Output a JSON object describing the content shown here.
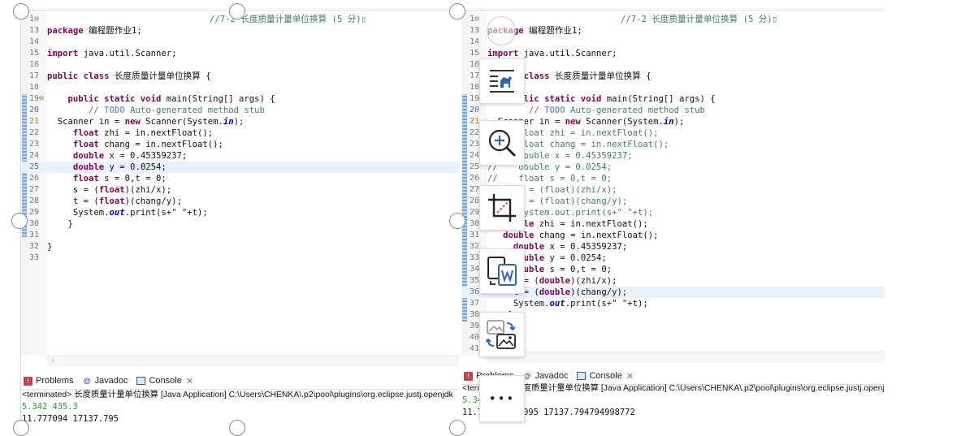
{
  "left": {
    "lines": [
      {
        "num": "1",
        "html": "<span style=\"padding-left:200px;color:#3f7f5f\">//7-2 长度质量计量单位换算 (5 分)▯</span>",
        "fold": true
      },
      {
        "num": "13",
        "html": "<span class=\"kw\">package</span> 编程题作业1;"
      },
      {
        "num": "14",
        "html": ""
      },
      {
        "num": "15",
        "html": "<span class=\"kw\">import</span> java.util.Scanner;"
      },
      {
        "num": "16",
        "html": ""
      },
      {
        "num": "17",
        "html": "<span class=\"kw\">public class</span> 长度质量计量单位换算 {"
      },
      {
        "num": "18",
        "html": ""
      },
      {
        "num": "19",
        "html": "    <span class=\"kw\">public static void</span> main(String[] args) {",
        "fold": true
      },
      {
        "num": "20",
        "html": "        <span class=\"cm\">// <span class=\"todo\">TODO</span> Auto-generated method stub</span>",
        "marker": "task"
      },
      {
        "num": "21",
        "html": "  Scanner in = <span class=\"kw\">new</span> Scanner(System.<span class=\"fld\">in</span>);",
        "marker": "warn"
      },
      {
        "num": "22",
        "html": "     <span class=\"kw\">float</span> zhi = in.nextFloat();"
      },
      {
        "num": "23",
        "html": "     <span class=\"kw\">float</span> chang = in.nextFloat();"
      },
      {
        "num": "24",
        "html": "     <span class=\"kw\">double</span> x = 0.45359237;"
      },
      {
        "num": "25",
        "html": "     <span class=\"kw\">double</span> y = 0.0254;",
        "hl": true
      },
      {
        "num": "26",
        "html": "     <span class=\"kw\">float</span> s = 0,t = 0;"
      },
      {
        "num": "27",
        "html": "     s = (<span class=\"kw\">float</span>)(zhi/x);"
      },
      {
        "num": "28",
        "html": "     t = (<span class=\"kw\">float</span>)(chang/y);"
      },
      {
        "num": "29",
        "html": "     System.<span class=\"fld\">out</span>.print(s+\" \"+t);"
      },
      {
        "num": "30",
        "html": "    }"
      },
      {
        "num": "31",
        "html": ""
      },
      {
        "num": "32",
        "html": "}"
      },
      {
        "num": "33",
        "html": ""
      }
    ],
    "tabs": {
      "problems": "Problems",
      "javadoc": "Javadoc",
      "console": "Console"
    },
    "terminated": "<terminated> 长度质量计量单位换算 [Java Application] C:\\Users\\CHENKA\\.p2\\pool\\plugins\\org.eclipse.justj.openjdk",
    "input": "5.342 435.3",
    "output": "11.777094 17137.795"
  },
  "right": {
    "lines": [
      {
        "num": "1",
        "html": "<span style=\"padding-left:164px;color:#3f7f5f\">//7-2 长度质量计量单位换算 (5 分)▯</span>",
        "fold": true
      },
      {
        "num": "13",
        "html": "<span class=\"kw\">package</span> 编程题作业1;"
      },
      {
        "num": "14",
        "html": ""
      },
      {
        "num": "15",
        "html": "<span class=\"kw\">import</span> java.util.Scanner;"
      },
      {
        "num": "16",
        "html": ""
      },
      {
        "num": "17",
        "html": "<span class=\"kw\">public class</span> 长度质量计量单位换算 {"
      },
      {
        "num": "18",
        "html": ""
      },
      {
        "num": "19",
        "html": "    <span class=\"kw\">public static void</span> main(String[] args) {",
        "fold": true
      },
      {
        "num": "20",
        "html": "        <span class=\"cm\">// <span class=\"todo\">TODO</span> Auto-generated method stub</span>",
        "marker": "task"
      },
      {
        "num": "21",
        "html": "  Scanner in = <span class=\"kw\">new</span> Scanner(System.<span class=\"fld\">in</span>);",
        "marker": "warn"
      },
      {
        "num": "22",
        "html": "<span class=\"cm\">//    float zhi = in.nextFloat();</span>"
      },
      {
        "num": "23",
        "html": "<span class=\"cm\">//    float chang = in.nextFloat();</span>"
      },
      {
        "num": "24",
        "html": "<span class=\"cm\">//    double x = 0.45359237;</span>"
      },
      {
        "num": "25",
        "html": "<span class=\"cm\">//    double y = 0.0254;</span>"
      },
      {
        "num": "26",
        "html": "<span class=\"cm\">//    float s = 0,t = 0;</span>"
      },
      {
        "num": "27",
        "html": "<span class=\"cm\">//    s = (float)(zhi/x);</span>"
      },
      {
        "num": "28",
        "html": "<span class=\"cm\">//    t = (float)(chang/y);</span>"
      },
      {
        "num": "29",
        "html": "<span class=\"cm\">//    System.out.print(s+\" \"+t);</span>"
      },
      {
        "num": "30",
        "html": "   <span class=\"kw\">double</span> zhi = in.nextFloat();"
      },
      {
        "num": "31",
        "html": "   <span class=\"kw\">double</span> chang = in.nextFloat();"
      },
      {
        "num": "32",
        "html": "     <span class=\"kw\">double</span> x = 0.45359237;"
      },
      {
        "num": "33",
        "html": "     <span class=\"kw\">double</span> y = 0.0254;"
      },
      {
        "num": "34",
        "html": "     <span class=\"kw\">double</span> s = 0,t = 0;"
      },
      {
        "num": "35",
        "html": "     s = (<span class=\"kw\">double</span>)(zhi/x);"
      },
      {
        "num": "36",
        "html": "     t = (<span class=\"kw\">double</span>)(chang/y);",
        "hl": true
      },
      {
        "num": "37",
        "html": "     System.<span class=\"fld\">out</span>.print(s+\" \"+t);"
      },
      {
        "num": "38",
        "html": "    }"
      },
      {
        "num": "39",
        "html": ""
      },
      {
        "num": "40",
        "html": "}"
      },
      {
        "num": "41",
        "html": ""
      }
    ],
    "tabs": {
      "problems": "Problems",
      "javadoc": "Javadoc",
      "console": "Console"
    },
    "terminated": "<terminated> 长度质量计量单位换算 [Java Application] C:\\Users\\CHENKA\\.p2\\pool\\plugins\\org.eclipse.justj.openjdk",
    "input": "5.342 435.3",
    "output": "11.777094736095 17137.794794998772"
  },
  "toolbar": {
    "buttons": [
      {
        "name": "ocr-text-icon"
      },
      {
        "name": "zoom-in-icon"
      },
      {
        "name": "crop-icon"
      },
      {
        "name": "convert-to-word-icon"
      },
      {
        "name": "image-replace-icon"
      },
      {
        "name": "more-icon",
        "label": "•••"
      }
    ]
  }
}
